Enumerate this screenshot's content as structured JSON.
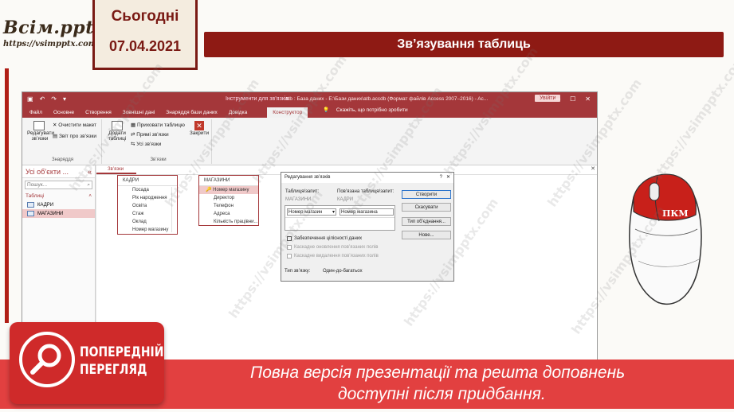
{
  "logo": {
    "name": "Всім.pptx",
    "url": "https://vsimpptx.com"
  },
  "date_tab": {
    "today": "Сьогодні",
    "date": "07.04.2021"
  },
  "slide_title": "Зв’язування таблиць",
  "watermark": "https://vsimpptx.com",
  "access": {
    "titlebar": {
      "context_tools": "Інструменти для зв’язків",
      "doc_title": "atb : База даних - E:\\Бази даних\\atb.accdb (Формат файлів Access 2007–2016) - Ac...",
      "signin": "Увійти"
    },
    "tabs": [
      "Файл",
      "Основне",
      "Створення",
      "Зовнішні дані",
      "Знаряддя бази даних",
      "Довідка",
      "Конструктор"
    ],
    "active_tab": "Конструктор",
    "tell_me": "Скажіть, що потрібно зробити",
    "ribbon": {
      "edit_relationships": "Редагувати зв’язки",
      "clear_layout": "Очистити макет",
      "relationship_report": "Звіт про зв’язки",
      "tools_group": "Знаряддя",
      "add_tables": "Додати таблиці",
      "hide_table": "Приховати таблицю",
      "direct_relationships": "Прямі зв’язки",
      "all_relationships": "Усі зв’язки",
      "relationships_group": "Зв’язки",
      "close": "Закрити"
    },
    "nav": {
      "header": "Усі об’єкти ...",
      "search_placeholder": "Пошук...",
      "section": "Таблиці",
      "items": [
        {
          "label": "КАДРИ"
        },
        {
          "label": "МАГАЗИНИ"
        }
      ]
    },
    "doc_tab": "Зв’язки",
    "tables": {
      "kadry": {
        "title": "КАДРИ",
        "fields": [
          "Посада",
          "Рік народження",
          "Освіта",
          "Стаж",
          "Оклад",
          "Номер магазину"
        ]
      },
      "magazyny": {
        "title": "МАГАЗИНИ",
        "fields": [
          "Номер магазину",
          "Директор",
          "Телефон",
          "Адреса",
          "Кількість працівни..."
        ]
      }
    },
    "dialog": {
      "title": "Редагування зв’язків",
      "help": "?",
      "table_label": "Таблиця/запит:",
      "related_label": "Пов’язана таблиця/запит:",
      "table_value": "МАГАЗИНИ",
      "related_value": "КАДРИ",
      "field_left": "Номер магазин",
      "field_right": "Номер магазина",
      "btn_create": "Створити",
      "btn_cancel": "Скасувати",
      "btn_join": "Тип об’єднання...",
      "btn_new": "Нове...",
      "chk_integrity": "Забезпечення цілісності даних",
      "chk_cascade_update": "Каскадне оновлення пов’язаних полів",
      "chk_cascade_delete": "Каскадне видалення пов’язаних полів",
      "rel_type_label": "Тип зв’язку:",
      "rel_type_value": "Один-до-багатьох"
    }
  },
  "mouse_label": "ПКМ",
  "preview": {
    "line1": "ПОПЕРЕДНІЙ",
    "line2": "ПЕРЕГЛЯД"
  },
  "banner": {
    "line1": "Повна версія презентації та решта доповнень",
    "line2": "доступні після придбання."
  }
}
